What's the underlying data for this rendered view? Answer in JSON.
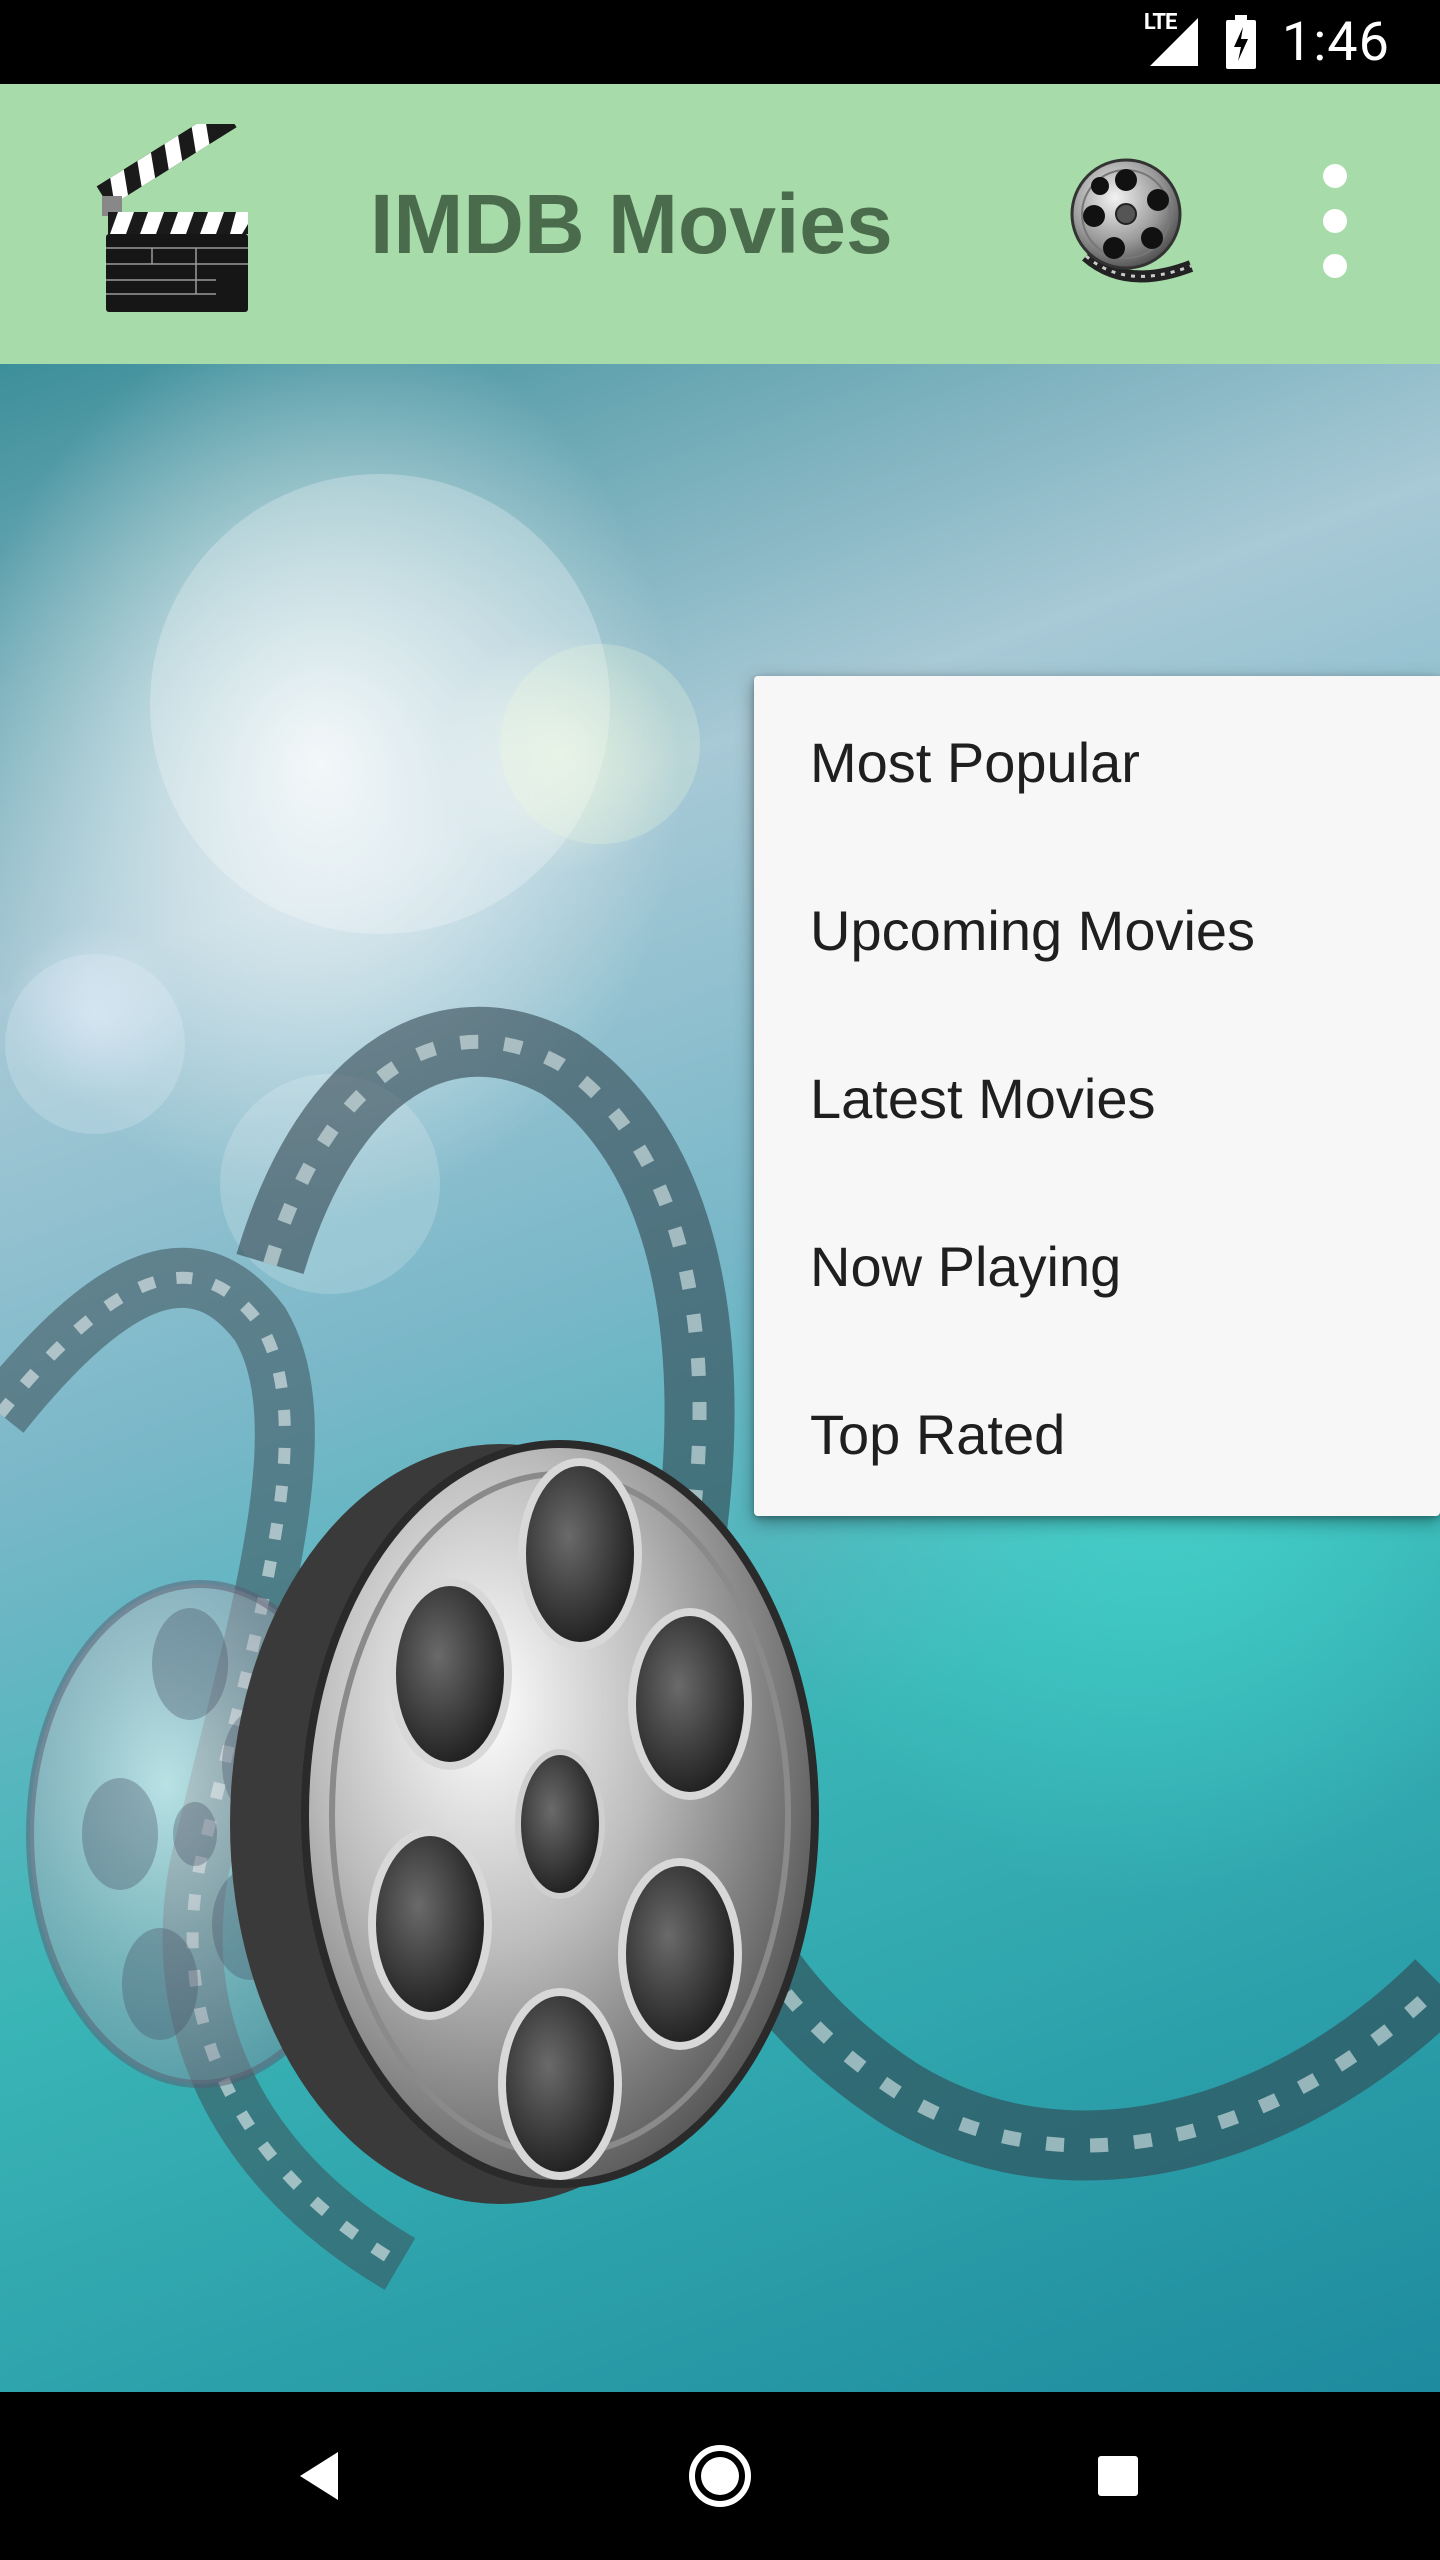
{
  "status_bar": {
    "time": "1:46",
    "network_label": "LTE",
    "icons": [
      "signal-icon",
      "battery-charging-icon"
    ]
  },
  "app_bar": {
    "title": "IMDB Movies",
    "icons": [
      "clapperboard-icon",
      "film-reel-icon",
      "overflow-menu-icon"
    ],
    "title_color": "#4a6b4c",
    "background": "#a7dba9"
  },
  "menu": {
    "items": [
      {
        "label": "Most Popular"
      },
      {
        "label": "Upcoming Movies"
      },
      {
        "label": "Latest Movies"
      },
      {
        "label": "Now Playing"
      },
      {
        "label": "Top Rated"
      }
    ],
    "background": "#f7f7f7"
  },
  "nav_bar": {
    "buttons": [
      "back-icon",
      "home-icon",
      "recents-icon"
    ]
  }
}
